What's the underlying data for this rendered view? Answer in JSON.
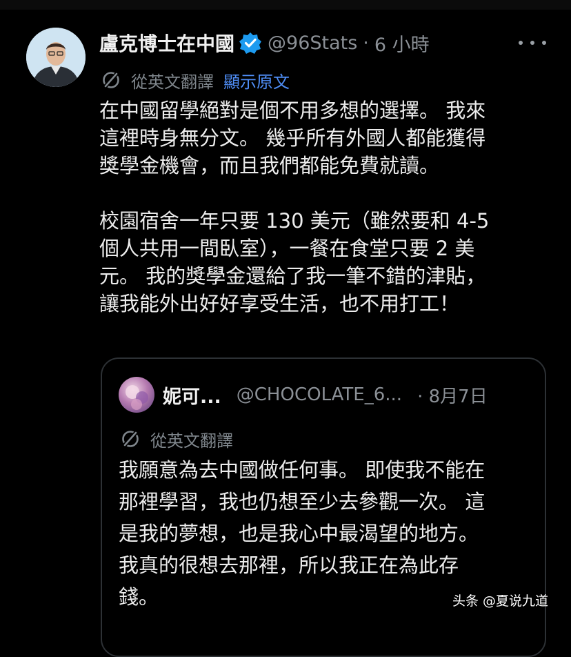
{
  "tweet": {
    "display_name": "盧克博士在中國",
    "handle": "@96Stats",
    "separator": "·",
    "time": "6 小時",
    "translate_label": "從英文翻譯",
    "show_original": "顯示原文",
    "text_lines_p1": [
      "在中國留學絕對是個不用多想的選擇。 我來",
      "這裡時身無分文。 幾乎所有外國人都能獲得",
      "獎學金機會，而且我們都能免費就讀。"
    ],
    "text_lines_p2": [
      "校園宿舍一年只要 130 美元（雖然要和 4-5",
      "個人共用一間臥室），一餐在食堂只要 2 美",
      "元。 我的獎學金還給了我一筆不錯的津貼，",
      "讓我能外出好好享受生活，也不用打工！"
    ]
  },
  "quoted": {
    "display_name": "妮可...",
    "handle": "@CHOCOLATE_6...",
    "date": "· 8月7日",
    "translate_label": "從英文翻譯",
    "text_lines": [
      "我願意為去中國做任何事。 即使我不能在",
      "那裡學習，我也仍想至少去參觀一次。 這",
      "是我的夢想，也是我心中最渴望的地方。",
      "我真的很想去那裡，所以我正在為此存",
      "錢。"
    ]
  },
  "watermark": "头条 @夏说九道",
  "colors": {
    "background": "#000000",
    "text": "#ececec",
    "muted": "#8b9096",
    "link": "#4f8ef7",
    "verified": "#1d9bf0",
    "card_border": "#2d3135"
  },
  "icons": {
    "verified": "verified-badge-icon",
    "translate": "translate-icon",
    "more": "more-options-icon"
  }
}
